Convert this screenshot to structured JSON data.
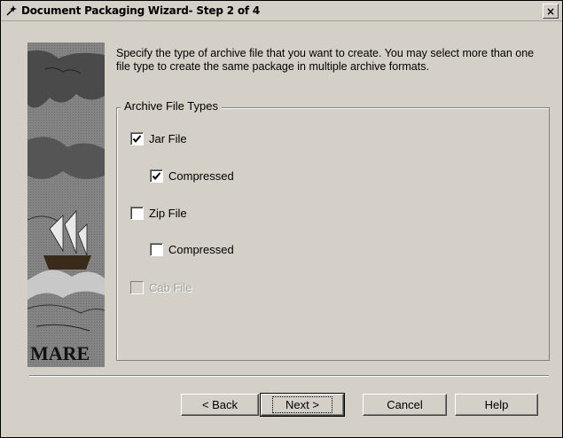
{
  "window": {
    "title": "Document Packaging Wizard- Step 2 of 4",
    "icon": "wizard-icon",
    "close_label": "×"
  },
  "content": {
    "description": "Specify the type of archive file that you want to create.  You may select more than one file type to create the same package in multiple archive formats.",
    "image_caption": "MARE"
  },
  "archive_group": {
    "legend": "Archive File Types",
    "options": [
      {
        "label": "Jar File",
        "checked": true,
        "enabled": true
      },
      {
        "label": "Compressed",
        "checked": true,
        "enabled": true
      },
      {
        "label": "Zip File",
        "checked": false,
        "enabled": true
      },
      {
        "label": "Compressed",
        "checked": false,
        "enabled": true
      },
      {
        "label": "Cab File",
        "checked": false,
        "enabled": false
      }
    ]
  },
  "buttons": {
    "back": "< Back",
    "next": "Next >",
    "cancel": "Cancel",
    "help": "Help"
  }
}
